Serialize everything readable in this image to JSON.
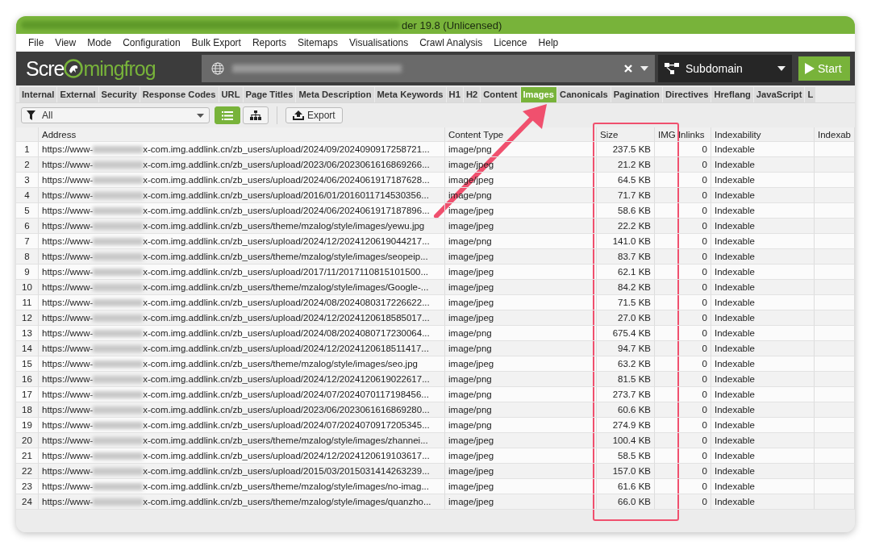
{
  "window": {
    "title": "der 19.8 (Unlicensed)"
  },
  "menu": [
    "File",
    "View",
    "Mode",
    "Configuration",
    "Bulk Export",
    "Reports",
    "Sitemaps",
    "Visualisations",
    "Crawl Analysis",
    "Licence",
    "Help"
  ],
  "logo": {
    "start": "Scre",
    "end": "mingfrog"
  },
  "mode_dropdown": {
    "value": "Subdomain"
  },
  "start_button": {
    "label": "Start"
  },
  "tabs": [
    {
      "label": "Internal",
      "selected": false
    },
    {
      "label": "External",
      "selected": false
    },
    {
      "label": "Security",
      "selected": false
    },
    {
      "label": "Response Codes",
      "selected": false
    },
    {
      "label": "URL",
      "selected": false
    },
    {
      "label": "Page Titles",
      "selected": false
    },
    {
      "label": "Meta Description",
      "selected": false
    },
    {
      "label": "Meta Keywords",
      "selected": false
    },
    {
      "label": "H1",
      "selected": false
    },
    {
      "label": "H2",
      "selected": false
    },
    {
      "label": "Content",
      "selected": false
    },
    {
      "label": "Images",
      "selected": true
    },
    {
      "label": "Canonicals",
      "selected": false
    },
    {
      "label": "Pagination",
      "selected": false
    },
    {
      "label": "Directives",
      "selected": false
    },
    {
      "label": "Hreflang",
      "selected": false
    },
    {
      "label": "JavaScript",
      "selected": false
    },
    {
      "label": "L",
      "selected": false
    }
  ],
  "filter": {
    "value": "All"
  },
  "view_buttons": [
    {
      "kind": "list",
      "selected": true
    },
    {
      "kind": "tree",
      "selected": false
    }
  ],
  "export_button": {
    "label": "Export"
  },
  "table": {
    "columns": [
      "Address",
      "Content Type",
      "Size",
      "IMG Inlinks",
      "Indexability",
      "Indexab"
    ],
    "rows": [
      {
        "n": "1",
        "address_start": "https://www-",
        "address_end": "x-com.img.addlink.cn/zb_users/upload/2024/09/2024090917258721...",
        "content_type": "image/png",
        "size": "237.5 KB",
        "inlinks": "0",
        "indexability": "Indexable"
      },
      {
        "n": "2",
        "address_start": "https://www-",
        "address_end": "x-com.img.addlink.cn/zb_users/upload/2023/06/2023061616869266...",
        "content_type": "image/jpeg",
        "size": "21.2 KB",
        "inlinks": "0",
        "indexability": "Indexable"
      },
      {
        "n": "3",
        "address_start": "https://www-",
        "address_end": "x-com.img.addlink.cn/zb_users/upload/2024/06/2024061917187628...",
        "content_type": "image/jpeg",
        "size": "64.5 KB",
        "inlinks": "0",
        "indexability": "Indexable"
      },
      {
        "n": "4",
        "address_start": "https://www-",
        "address_end": "x-com.img.addlink.cn/zb_users/upload/2016/01/2016011714530356...",
        "content_type": "image/png",
        "size": "71.7 KB",
        "inlinks": "0",
        "indexability": "Indexable"
      },
      {
        "n": "5",
        "address_start": "https://www-",
        "address_end": "x-com.img.addlink.cn/zb_users/upload/2024/06/2024061917187896...",
        "content_type": "image/jpeg",
        "size": "58.6 KB",
        "inlinks": "0",
        "indexability": "Indexable"
      },
      {
        "n": "6",
        "address_start": "https://www-",
        "address_end": "x-com.img.addlink.cn/zb_users/theme/mzalog/style/images/yewu.jpg",
        "content_type": "image/jpeg",
        "size": "22.2 KB",
        "inlinks": "0",
        "indexability": "Indexable"
      },
      {
        "n": "7",
        "address_start": "https://www-",
        "address_end": "x-com.img.addlink.cn/zb_users/upload/2024/12/2024120619044217...",
        "content_type": "image/png",
        "size": "141.0 KB",
        "inlinks": "0",
        "indexability": "Indexable"
      },
      {
        "n": "8",
        "address_start": "https://www-",
        "address_end": "x-com.img.addlink.cn/zb_users/theme/mzalog/style/images/seopeip...",
        "content_type": "image/jpeg",
        "size": "83.7 KB",
        "inlinks": "0",
        "indexability": "Indexable"
      },
      {
        "n": "9",
        "address_start": "https://www-",
        "address_end": "x-com.img.addlink.cn/zb_users/upload/2017/11/2017110815101500...",
        "content_type": "image/jpeg",
        "size": "62.1 KB",
        "inlinks": "0",
        "indexability": "Indexable"
      },
      {
        "n": "10",
        "address_start": "https://www-",
        "address_end": "x-com.img.addlink.cn/zb_users/theme/mzalog/style/images/Google-...",
        "content_type": "image/jpeg",
        "size": "84.2 KB",
        "inlinks": "0",
        "indexability": "Indexable"
      },
      {
        "n": "11",
        "address_start": "https://www-",
        "address_end": "x-com.img.addlink.cn/zb_users/upload/2024/08/2024080317226622...",
        "content_type": "image/jpeg",
        "size": "71.5 KB",
        "inlinks": "0",
        "indexability": "Indexable"
      },
      {
        "n": "12",
        "address_start": "https://www-",
        "address_end": "x-com.img.addlink.cn/zb_users/upload/2024/12/2024120618585017...",
        "content_type": "image/jpeg",
        "size": "27.0 KB",
        "inlinks": "0",
        "indexability": "Indexable"
      },
      {
        "n": "13",
        "address_start": "https://www-",
        "address_end": "x-com.img.addlink.cn/zb_users/upload/2024/08/2024080717230064...",
        "content_type": "image/png",
        "size": "675.4 KB",
        "inlinks": "0",
        "indexability": "Indexable"
      },
      {
        "n": "14",
        "address_start": "https://www-",
        "address_end": "x-com.img.addlink.cn/zb_users/upload/2024/12/2024120618511417...",
        "content_type": "image/png",
        "size": "94.7 KB",
        "inlinks": "0",
        "indexability": "Indexable"
      },
      {
        "n": "15",
        "address_start": "https://www-",
        "address_end": "x-com.img.addlink.cn/zb_users/theme/mzalog/style/images/seo.jpg",
        "content_type": "image/jpeg",
        "size": "63.2 KB",
        "inlinks": "0",
        "indexability": "Indexable"
      },
      {
        "n": "16",
        "address_start": "https://www-",
        "address_end": "x-com.img.addlink.cn/zb_users/upload/2024/12/2024120619022617...",
        "content_type": "image/png",
        "size": "81.5 KB",
        "inlinks": "0",
        "indexability": "Indexable"
      },
      {
        "n": "17",
        "address_start": "https://www-",
        "address_end": "x-com.img.addlink.cn/zb_users/upload/2024/07/2024070117198456...",
        "content_type": "image/png",
        "size": "273.7 KB",
        "inlinks": "0",
        "indexability": "Indexable"
      },
      {
        "n": "18",
        "address_start": "https://www-",
        "address_end": "x-com.img.addlink.cn/zb_users/upload/2023/06/2023061616869280...",
        "content_type": "image/png",
        "size": "60.6 KB",
        "inlinks": "0",
        "indexability": "Indexable"
      },
      {
        "n": "19",
        "address_start": "https://www-",
        "address_end": "x-com.img.addlink.cn/zb_users/upload/2024/07/2024070917205345...",
        "content_type": "image/png",
        "size": "274.9 KB",
        "inlinks": "0",
        "indexability": "Indexable"
      },
      {
        "n": "20",
        "address_start": "https://www-",
        "address_end": "x-com.img.addlink.cn/zb_users/theme/mzalog/style/images/zhannei...",
        "content_type": "image/jpeg",
        "size": "100.4 KB",
        "inlinks": "0",
        "indexability": "Indexable"
      },
      {
        "n": "21",
        "address_start": "https://www-",
        "address_end": "x-com.img.addlink.cn/zb_users/upload/2024/12/2024120619103617...",
        "content_type": "image/jpeg",
        "size": "58.5 KB",
        "inlinks": "0",
        "indexability": "Indexable"
      },
      {
        "n": "22",
        "address_start": "https://www-",
        "address_end": "x-com.img.addlink.cn/zb_users/upload/2015/03/2015031414263239...",
        "content_type": "image/jpeg",
        "size": "157.0 KB",
        "inlinks": "0",
        "indexability": "Indexable"
      },
      {
        "n": "23",
        "address_start": "https://www-",
        "address_end": "x-com.img.addlink.cn/zb_users/theme/mzalog/style/images/no-imag...",
        "content_type": "image/jpeg",
        "size": "61.6 KB",
        "inlinks": "0",
        "indexability": "Indexable"
      },
      {
        "n": "24",
        "address_start": "https://www-",
        "address_end": "x-com.img.addlink.cn/zb_users/theme/mzalog/style/images/quanzho...",
        "content_type": "image/jpeg",
        "size": "66.0 KB",
        "inlinks": "0",
        "indexability": "Indexable"
      }
    ]
  }
}
